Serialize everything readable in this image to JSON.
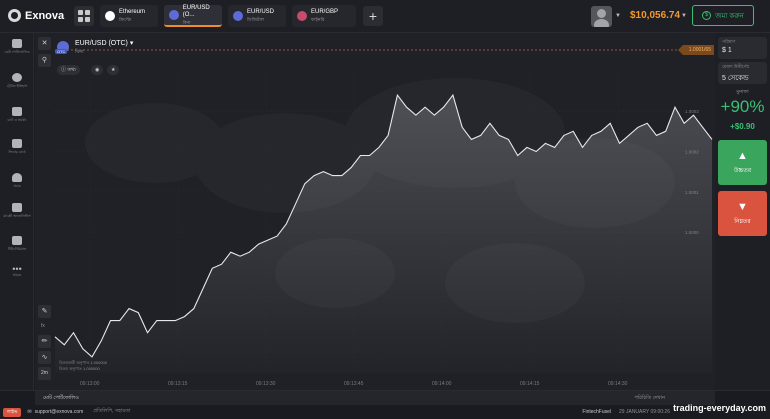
{
  "app": {
    "name": "Exnova"
  },
  "tabs": [
    {
      "name": "Ethereum",
      "sub": "ক্রিপ্টো",
      "color": "#ffffff"
    },
    {
      "name": "EUR/USD (O...",
      "sub": "বিনা",
      "color": "#5c6bd6"
    },
    {
      "name": "EUR/USD",
      "sub": "ডিজিটাল",
      "color": "#5c6bd6"
    },
    {
      "name": "EUR/GBP",
      "sub": "ফাইনরি",
      "color": "#c74c6b"
    }
  ],
  "header": {
    "balance": "$10,056.74",
    "deposit_label": "জমা করুন",
    "deposit_icon": "$",
    "accent_color": "#f39a2c",
    "deposit_color": "#38c172"
  },
  "sidebar": [
    {
      "icon": "briefcase-icon",
      "label": "মোট পোর্টফোলিও"
    },
    {
      "icon": "clock-icon",
      "label": "ট্রেডিং ইতিহাস"
    },
    {
      "icon": "chat-icon",
      "label": "চ্যাট ও সমর্থন"
    },
    {
      "icon": "trophy-icon",
      "label": "লিডার বোর্ড"
    },
    {
      "icon": "fire-icon",
      "label": "প্রচার"
    },
    {
      "icon": "chart-icon",
      "label": "মার্কেট অ্যানালিসিস"
    },
    {
      "icon": "graduation-icon",
      "label": "টিউটোরিয়াল"
    },
    {
      "icon": "more-icon",
      "label": "আরও"
    }
  ],
  "chart_header": {
    "asset": "EUR/USD (OTC)",
    "asset_sub": "বিনা",
    "badge": "OTC",
    "pill_info": "তথ্য",
    "price_tag": "1.0001/65"
  },
  "chart_legend": {
    "line1": "বিক্রয়কারী অনুপাত 1.000000",
    "line2": "বিক্রয় অনুপাত 1.000000"
  },
  "chart_data": {
    "type": "area",
    "x_ticks": [
      "09:13:00",
      "09:13:15",
      "09:13:30",
      "09:13:45",
      "09:14:00",
      "09:14:15",
      "09:14:30"
    ],
    "y_ticks": [
      "1.0003",
      "1.0002",
      "1.0001",
      "1.0000"
    ],
    "values": [
      0.99974,
      0.99972,
      0.99975,
      0.99971,
      0.99969,
      0.99973,
      0.99978,
      0.99978,
      0.99981,
      0.9998,
      0.99975,
      0.99978,
      0.99978,
      0.99978,
      0.99979,
      0.99981,
      0.99986,
      0.99991,
      0.99992,
      0.99995,
      0.99994,
      0.99995,
      0.99997,
      0.99998,
      0.99999,
      1.00002,
      1.00007,
      1.00012,
      1.00014,
      1.00015,
      1.00014,
      1.00014,
      1.00016,
      1.00019,
      1.00019,
      1.00021,
      1.00024,
      1.00034,
      1.00031,
      1.00029,
      1.00031,
      1.00029,
      1.00031,
      1.00034,
      1.00026,
      1.00023,
      1.00024,
      1.00027,
      1.00024,
      1.00023,
      1.00019,
      1.00021,
      1.0002,
      1.00022,
      1.00021,
      1.00024,
      1.00025,
      1.00021,
      1.00024,
      1.00025,
      1.00027,
      1.00022,
      1.00024,
      1.00026,
      1.00027,
      1.00024,
      1.00025,
      1.00031,
      1.00027,
      1.00029,
      1.00026,
      1.00023
    ],
    "ylim": [
      0.99965,
      1.00037
    ],
    "grid": true
  },
  "right_panel": {
    "time_label": "পরিমাণ",
    "time_value": "$ 1",
    "expiry_label": "মেয়াদ উত্তীর্ণের",
    "expiry_value": "5 সেকেন্ড",
    "payout_label": "মুনাফা",
    "payout": "+90%",
    "payout_amount": "+$0.90",
    "up_label": "উচ্চতর",
    "down_label": "নিম্নতর"
  },
  "bottom": {
    "portfolio": "মোট পোর্টফোলিও",
    "portfolio_right": "পরিচিতি দেখান",
    "live_badge": "লাইভ",
    "email": "support@exnova.com",
    "links": "প্রতিলিপি, সহায়তা",
    "fintech": "FintechFusel",
    "footer_time": "29 JANUARY 09:00:26",
    "watermark": "trading-everyday.com"
  }
}
